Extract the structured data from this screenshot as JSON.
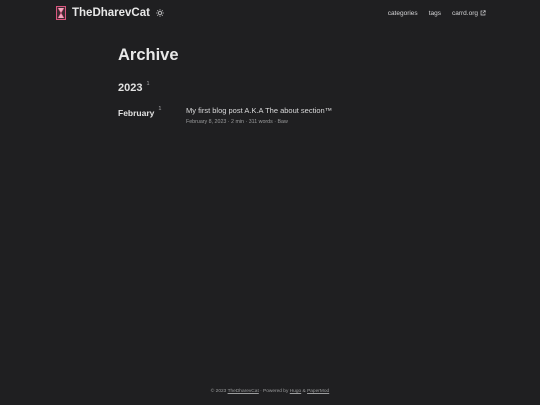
{
  "header": {
    "site_title": "TheDharevCat",
    "logo_icon": "hourglass-logo-icon",
    "theme_toggle_icon": "sun-icon",
    "nav": [
      {
        "label": "categories"
      },
      {
        "label": "tags"
      },
      {
        "label": "carrd.org",
        "icon": "external-link-icon"
      }
    ]
  },
  "main": {
    "title": "Archive",
    "years": [
      {
        "year": "2023",
        "count": "1",
        "months": [
          {
            "month": "February",
            "count": "1",
            "entries": [
              {
                "title": "My first blog post A.K.A The about section™",
                "meta": "February 8, 2023 · 2 min · 311 words · Baw"
              }
            ]
          }
        ]
      }
    ]
  },
  "footer": {
    "prefix": "© 2023 ",
    "site_link": "TheDharevCat",
    "powered": " · Powered by ",
    "hugo_link": "Hugo",
    "amp": " & ",
    "papermod_link": "PaperMod"
  },
  "colors": {
    "background": "#1f1f21",
    "primary_text": "#dadadb",
    "secondary_text": "#9b9c9d",
    "logo_accent": "#d9567f"
  }
}
